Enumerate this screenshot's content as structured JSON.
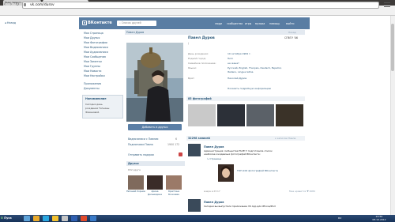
{
  "browser": {
    "tabs": [
      {
        "label": "Ради первого зверя..."
      },
      {
        "label": "Павел Дуров"
      }
    ],
    "url": "vk.com/durov"
  },
  "page": {
    "back_link": "Назад",
    "header": {
      "logo": "ВКонтакте",
      "logo_mark": "в",
      "search_placeholder": "Список друзей",
      "nav": [
        "люди",
        "сообщества",
        "игры",
        "музыка",
        "помощь",
        "выйти"
      ]
    },
    "left_menu": [
      "Моя Страница",
      "Мои Друзья",
      "Мои Фотографии",
      "Мои Видеозаписи",
      "Мои Аудиозаписи",
      "Мои Сообщения",
      "Мои Заметки",
      "Мои Группы",
      "Мои Новости",
      "Мои Настройки"
    ],
    "left_menu_extra": [
      "Приложения",
      "Документы"
    ],
    "notice": {
      "title": "Напоминание",
      "lines": [
        "Сегодня день",
        "рождения Татьяны",
        "Фазановой."
      ]
    },
    "main": {
      "head_name": "Павел Дуров",
      "head_back": "Назад"
    },
    "profile": {
      "name": "Павел Дуров",
      "status": "/",
      "org": "СПбГУ '06",
      "info": [
        {
          "label": "День рождения:",
          "value": "10 октября 1984 г."
        },
        {
          "label": "Родной город:",
          "value": "Turin"
        },
        {
          "label": "Семейное положение:",
          "value": "не женат"
        },
        {
          "label": "Языки:",
          "value": "Русский, English, Français, Deutsch, Español,"
        },
        {
          "label": "",
          "value": "Italiano, Lingua latina"
        },
        {
          "label": "Брат:",
          "value": "Николай Дуров"
        }
      ],
      "more_info": "Показать подробную информацию"
    },
    "left_col": {
      "add_friend": "Добавить в друзья",
      "links": [
        {
          "label": "Видеозаписи с Павлом",
          "count": "6"
        },
        {
          "label": "Подписчики Павла",
          "count": "1900 172"
        },
        {
          "label": "Отправить подарок",
          "count": ""
        }
      ]
    },
    "friends": {
      "title": "Друзья",
      "count": "632 друга",
      "items": [
        {
          "name": "Евгений Хорнов"
        },
        {
          "name": "Арина Дельвадина"
        },
        {
          "name": "Кристина Бочкаева"
        }
      ]
    },
    "photos": {
      "title": "85 фотографий"
    },
    "wall": {
      "title": "32298 записей",
      "link": "к записям Павла",
      "posts": [
        {
          "author": "Павел Дуров",
          "text": [
            "Администрация сообщества FACE!!! подготовила список",
            "наиболее ожидаемых фотографий ВКонтакте:"
          ],
          "repost_label": "Страница",
          "repost_title": "ТОП-100 фотографий ВКонтакте",
          "date": "вчера в 23:17",
          "likes": "Мне нравится ♥ 4084"
        },
        {
          "author": "Павел Дуров",
          "text": [
            "Сегодня вы выпустили приложение VK App для iPhone/iPod"
          ]
        }
      ]
    }
  },
  "taskbar": {
    "start": "Пуск",
    "lang": "RU",
    "time": "22:50",
    "date": "08.10.2012"
  },
  "colors": {
    "vk_blue": "#597da3",
    "link": "#2b587a",
    "taskbar": "#1f3d66"
  }
}
